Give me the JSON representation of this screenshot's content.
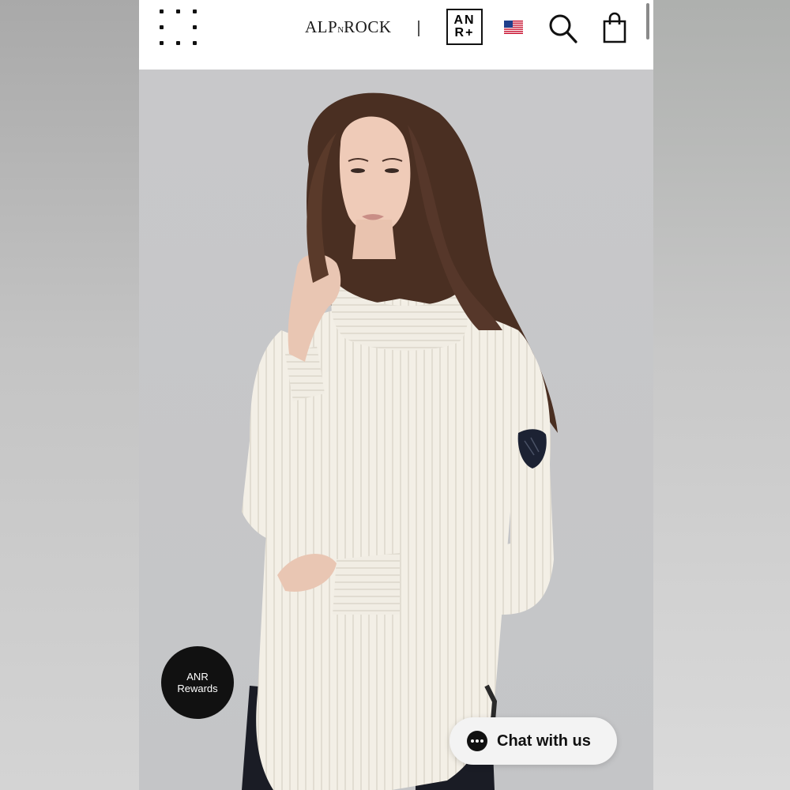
{
  "header": {
    "brand_main": "ALP",
    "brand_small": "N",
    "brand_end": "ROCK",
    "anr_line1": "AN",
    "anr_line2": "R+",
    "menu_icon": "grid-dots-icon",
    "flag_icon": "us-flag-icon",
    "search_icon": "search-icon",
    "bag_icon": "shopping-bag-icon"
  },
  "hero": {
    "image_description": "product-photo"
  },
  "rewards_button": {
    "line1": "ANR",
    "line2": "Rewards"
  },
  "chat_button": {
    "label": "Chat with us",
    "icon": "chat-bubble-icon"
  },
  "colors": {
    "header_bg": "#ffffff",
    "rewards_bg": "#111111",
    "chat_bg": "#f3f3f3",
    "sweater": "#f3efe6",
    "hair": "#4a2f22"
  }
}
